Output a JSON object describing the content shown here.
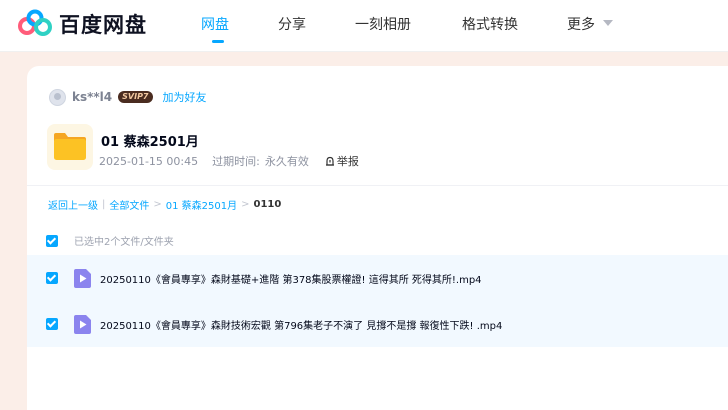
{
  "app": {
    "name": "百度网盘"
  },
  "nav": {
    "items": [
      "网盘",
      "分享",
      "一刻相册",
      "格式转换"
    ],
    "more_label": "更多",
    "active_index": 0
  },
  "share": {
    "username": "ks**l4",
    "badge": "SVIP7",
    "add_friend": "加为好友",
    "folder_title": "01 蔡森2501月",
    "date": "2025-01-15 00:45",
    "expire_label": "过期时间:",
    "expire_value": "永久有效",
    "report": "举报"
  },
  "breadcrumb": {
    "back": "返回上一级",
    "all_files": "全部文件",
    "folder": "01 蔡森2501月",
    "current": "0110",
    "separator": ">",
    "pipe": "|"
  },
  "selection": {
    "summary": "已选中2个文件/文件夹"
  },
  "files": [
    {
      "name": "20250110《會員專享》森財基礎+進階 第378集股票權證! 這得其所 死得其所!.mp4",
      "checked": true
    },
    {
      "name": "20250110《會員專享》森財技術宏觀 第796集老子不演了 見撐不是撐 報復性下跌! .mp4",
      "checked": true
    }
  ],
  "colors": {
    "accent": "#06a7ff",
    "folder": "#fcc224",
    "video_icon": "#8b84ee",
    "page_bg": "#fbeee8",
    "row_selected": "#f2f9ff"
  }
}
